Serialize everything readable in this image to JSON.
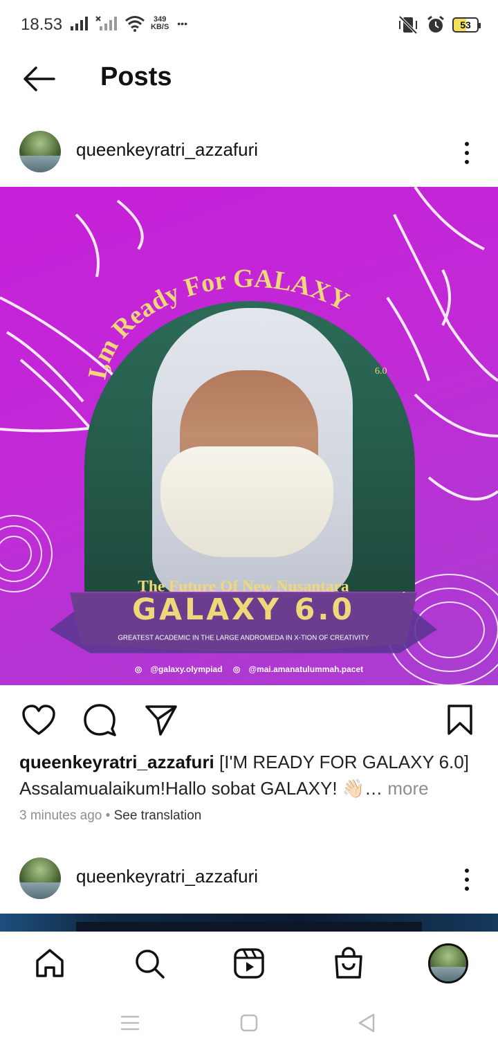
{
  "status_bar": {
    "time": "18.53",
    "net_speed_value": "349",
    "net_speed_unit": "KB/S",
    "overflow": "•••",
    "battery": "53"
  },
  "header": {
    "title": "Posts"
  },
  "post1": {
    "username": "queenkeyratri_azzafuri",
    "caption_line1": "[I'M READY FOR GALAXY 6.0]",
    "caption_line2": "Assalamualaikum!Hallo sobat GALAXY! 👋🏻…",
    "more_label": "more",
    "timestamp": "3 minutes ago",
    "separator": "•",
    "see_translation": "See translation",
    "image": {
      "ring_text": "I,m Ready For GALAXY",
      "ring_version": "6.0",
      "tagline": "The Future Of New Nusantara",
      "banner_title": "GALAXY 6.0",
      "banner_subtitle": "GREATEST ACADEMIC IN THE LARGE ANDROMEDA IN X-TION OF CREATIVITY",
      "social_1": "@galaxy.olympiad",
      "social_2": "@mai.amanatulummah.pacet"
    }
  },
  "post2": {
    "username": "queenkeyratri_azzafuri"
  },
  "colors": {
    "post_bg": "#c61fd9",
    "banner": "#6a3d8f",
    "gold": "#f0d77a",
    "arch_green": "#2c6b57"
  },
  "nav": {
    "items": [
      "home-icon",
      "search-icon",
      "reels-icon",
      "shop-icon",
      "profile-avatar"
    ]
  }
}
